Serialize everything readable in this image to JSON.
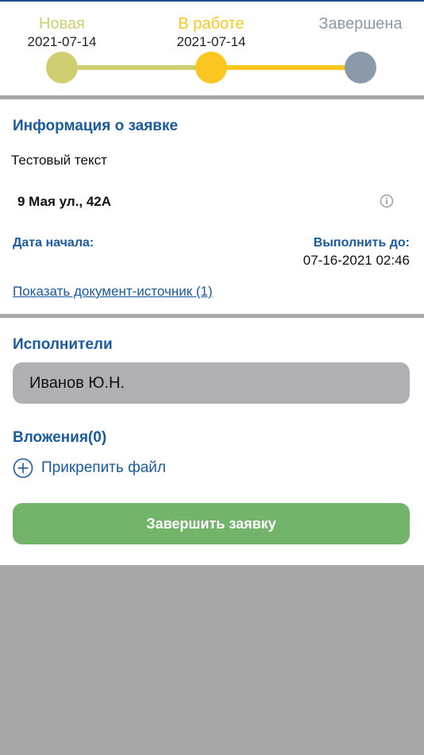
{
  "stepper": {
    "steps": [
      {
        "label": "Новая",
        "date": "2021-07-14",
        "color": "#cfcf72"
      },
      {
        "label": "В работе",
        "date": "2021-07-14",
        "color": "#fcc620"
      },
      {
        "label": "Завершена",
        "date": "",
        "color": "#8a9aaa"
      }
    ],
    "track_colors": [
      "#cfcf72",
      "#fcc620"
    ]
  },
  "info": {
    "title": "Информация о заявке",
    "description": "Тестовый текст",
    "address": "9 Мая ул., 42А",
    "start_label": "Дата начала:",
    "start_value": "",
    "due_label": "Выполнить до:",
    "due_value": "07-16-2021 02:46",
    "source_link": "Показать документ-источник (1)"
  },
  "executors": {
    "title": "Исполнители",
    "items": [
      "Иванов Ю.Н."
    ]
  },
  "attachments": {
    "title": "Вложения(0)",
    "attach_label": "Прикрепить файл"
  },
  "actions": {
    "finish_label": "Завершить заявку"
  },
  "colors": {
    "accent": "#1a5aa0",
    "finish_button": "#72b46a",
    "background": "#a8a8a8"
  }
}
